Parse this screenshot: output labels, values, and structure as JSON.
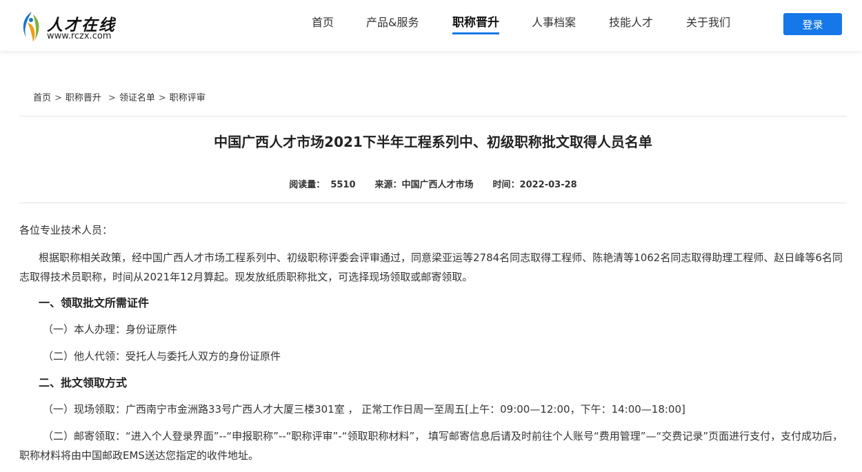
{
  "header": {
    "logo": {
      "title": "人才在线",
      "url": "www.rczx.com"
    },
    "nav": [
      {
        "label": "首页",
        "active": false
      },
      {
        "label": "产品&服务",
        "active": false
      },
      {
        "label": "职称晋升",
        "active": true
      },
      {
        "label": "人事档案",
        "active": false
      },
      {
        "label": "技能人才",
        "active": false
      },
      {
        "label": "关于我们",
        "active": false
      }
    ],
    "login_label": "登录"
  },
  "breadcrumb": {
    "items": [
      "首页",
      "职称晋升",
      "领证名单",
      "职称评审"
    ],
    "separator": ">"
  },
  "article": {
    "title": "中国广西人才市场2021下半年工程系列中、初级职称批文取得人员名单",
    "meta": {
      "views_label": "阅读量：",
      "views": "5510",
      "source_label": "来源：",
      "source": "中国广西人才市场",
      "time_label": "时间：",
      "time": "2022-03-28"
    },
    "greeting": "各位专业技术人员：",
    "intro": "根据职称相关政策，经中国广西人才市场工程系列中、初级职称评委会评审通过，同意梁亚运等2784名同志取得工程师、陈艳清等1062名同志取得助理工程师、赵日峰等6名同志取得技术员职称，时间从2021年12月算起。现发放纸质职称批文，可选择现场领取或邮寄领取。",
    "section1": {
      "heading": "一、领取批文所需证件",
      "items": [
        "（一）本人办理：身份证原件",
        "（二）他人代领：受托人与委托人双方的身份证原件"
      ]
    },
    "section2": {
      "heading": "二、批文领取方式",
      "items": [
        "（一）现场领取：广西南宁市金洲路33号广西人才大厦三楼301室 ， 正常工作日周一至周五[上午：09:00—12:00，下午：14:00—18:00]",
        "（二）邮寄领取：“进入个人登录界面”--“申报职称”--“职称评审”-“领取职称材料”， 填写邮寄信息后请及时前往个人账号“费用管理”—“交费记录”页面进行支付，支付成功后，职称材料将由中国邮政EMS送达您指定的收件地址。"
      ]
    }
  },
  "colors": {
    "accent": "#1677e8",
    "text": "#333333",
    "divider": "#e3e3e3"
  }
}
